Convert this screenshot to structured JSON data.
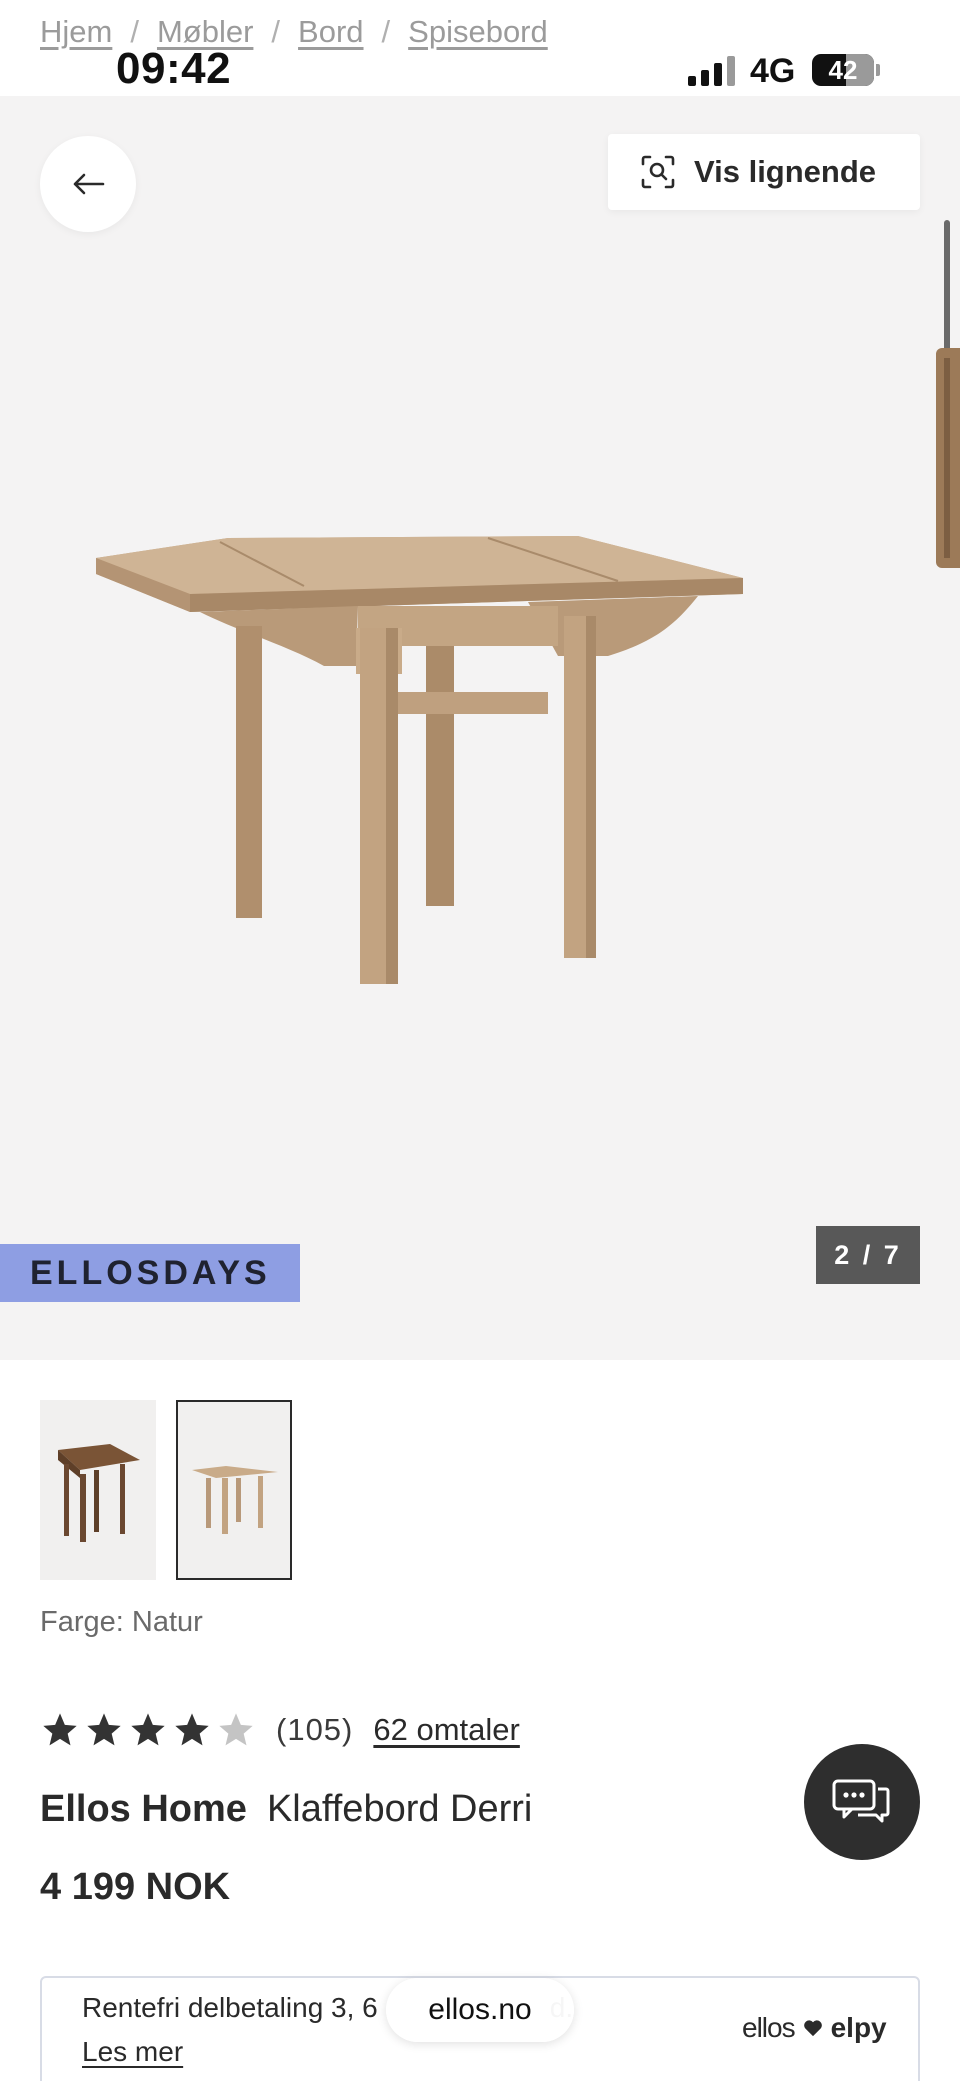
{
  "breadcrumb": [
    "Hjem",
    "Møbler",
    "Bord",
    "Spisebord"
  ],
  "breadcrumb_separator": "/",
  "status_bar": {
    "time": "09:42",
    "network": "4G",
    "battery": "42"
  },
  "gallery": {
    "similar_label": "Vis lignende",
    "promo_tag": "ELLOSDAYS",
    "counter": "2 / 7",
    "current_image": 2,
    "total_images": 7
  },
  "product": {
    "color_label": "Farge: Natur",
    "rating": 4,
    "rating_max": 5,
    "rating_count": "(105)",
    "reviews_link": "62 omtaler",
    "brand": "Ellos Home",
    "name": "Klaffebord Derri",
    "price": "4 199 NOK"
  },
  "finance": {
    "text": "Rentefri delbetaling 3, 6",
    "text_end": "d.",
    "link": "Les mer",
    "logo_left": "ellos",
    "logo_right": "elpy"
  },
  "browser": {
    "url": "ellos.no"
  },
  "colors": {
    "promo_bg": "#8e9ee3",
    "gallery_bg": "#f4f3f3",
    "wood": "#b89a77"
  },
  "icons": [
    "back-arrow-icon",
    "visual-search-icon",
    "star-icon",
    "chat-icon",
    "heart-icon"
  ]
}
